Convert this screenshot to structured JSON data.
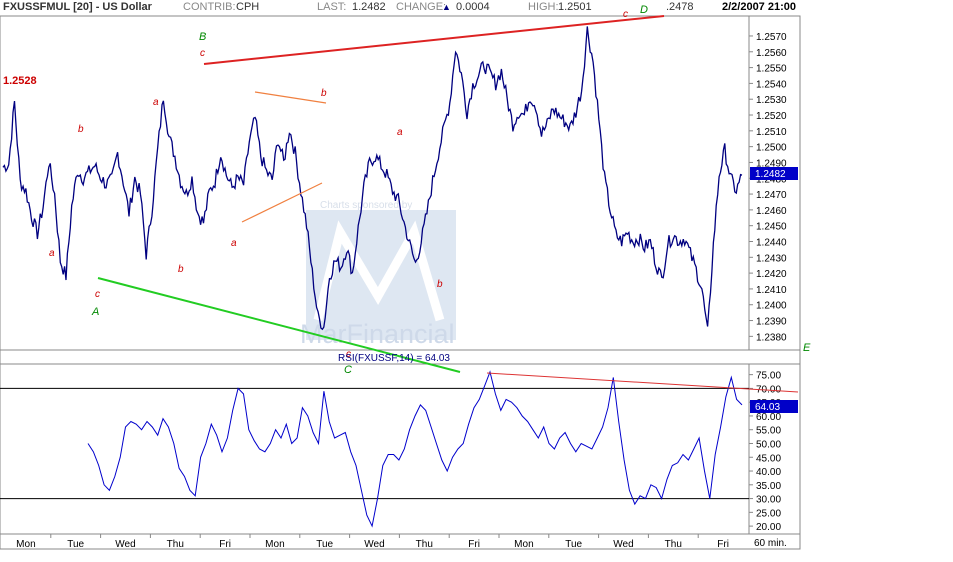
{
  "header": {
    "symbol": "FXUSSFMUL [20] - US Dollar",
    "contrib_label": "CONTRIB:",
    "contrib_value": "CPH",
    "last_label": "LAST:",
    "last_value": "1.2482",
    "change_label": "CHANGE:",
    "change_value": "0.0004",
    "high_label": "HIGH:",
    "high_value": "1.2501",
    "low_value": ".2478",
    "date": "2/2/2007 21:00"
  },
  "colors": {
    "price": "#000080",
    "rsi": "#0000cc",
    "resistance": "#dd2222",
    "support": "#22cc22",
    "triangle": "#f08040",
    "wave_red": "#cc0000",
    "wave_green": "#008800",
    "last_box": "#0000c8"
  },
  "chart_data": [
    {
      "type": "line",
      "title": "FXUSSFMUL [20] - US Dollar",
      "interval": "60 min.",
      "ylim": [
        1.2372,
        1.2582
      ],
      "y_ticks": [
        1.238,
        1.239,
        1.24,
        1.241,
        1.242,
        1.243,
        1.244,
        1.245,
        1.246,
        1.247,
        1.248,
        1.249,
        1.25,
        1.251,
        1.252,
        1.253,
        1.254,
        1.255,
        1.256,
        1.257
      ],
      "last_value": 1.2482,
      "marked_high": "1.2528",
      "watermark": "MarFinancial",
      "watermark_sub": "Charts sponsored by",
      "x_labels": [
        "Mon",
        "Tue",
        "Wed",
        "Thu",
        "Fri",
        "Mon",
        "Tue",
        "Wed",
        "Thu",
        "Fri",
        "Mon",
        "Tue",
        "Wed",
        "Thu",
        "Fri"
      ],
      "series": [
        {
          "values": [
            1.2487,
            1.2489,
            1.2528,
            1.2478,
            1.2472,
            1.2456,
            1.2445,
            1.2462,
            1.249,
            1.247,
            1.2428,
            1.2418,
            1.2462,
            1.2485,
            1.248,
            1.2484,
            1.2488,
            1.2481,
            1.2476,
            1.2479,
            1.2496,
            1.2478,
            1.2458,
            1.248,
            1.247,
            1.2432,
            1.246,
            1.2498,
            1.2532,
            1.2506,
            1.2494,
            1.2478,
            1.247,
            1.248,
            1.2458,
            1.2452,
            1.2471,
            1.2478,
            1.2496,
            1.2482,
            1.2474,
            1.248,
            1.2476,
            1.2503,
            1.2518,
            1.2494,
            1.2484,
            1.2479,
            1.2505,
            1.249,
            1.2511,
            1.2496,
            1.2472,
            1.245,
            1.242,
            1.2392,
            1.2386,
            1.2418,
            1.2428,
            1.2424,
            1.2436,
            1.242,
            1.2448,
            1.2474,
            1.249,
            1.2494,
            1.2488,
            1.2482,
            1.2472,
            1.2466,
            1.2452,
            1.2438,
            1.2426,
            1.244,
            1.2458,
            1.2478,
            1.2496,
            1.2512,
            1.2528,
            1.2562,
            1.2546,
            1.2522,
            1.2539,
            1.2545,
            1.2552,
            1.2546,
            1.254,
            1.2548,
            1.253,
            1.2514,
            1.2522,
            1.252,
            1.2532,
            1.2526,
            1.2508,
            1.2514,
            1.2524,
            1.252,
            1.2516,
            1.2512,
            1.2522,
            1.2536,
            1.2574,
            1.2554,
            1.2518,
            1.248,
            1.246,
            1.2444,
            1.244,
            1.2446,
            1.244,
            1.2442,
            1.2436,
            1.244,
            1.2426,
            1.2416,
            1.2438,
            1.2444,
            1.244,
            1.2442,
            1.2432,
            1.2422,
            1.241,
            1.2382,
            1.2438,
            1.2482,
            1.2498,
            1.248,
            1.2472,
            1.2482
          ]
        }
      ],
      "annotations": [
        {
          "text": "B",
          "color": "green"
        },
        {
          "text": "c",
          "color": "red"
        },
        {
          "text": "D",
          "color": "green"
        },
        {
          "text": "c",
          "color": "red"
        },
        {
          "text": "a",
          "color": "red"
        },
        {
          "text": "b",
          "color": "red"
        },
        {
          "text": "a",
          "color": "red"
        },
        {
          "text": "b",
          "color": "red"
        },
        {
          "text": "a",
          "color": "red"
        },
        {
          "text": "b",
          "color": "red"
        },
        {
          "text": "a",
          "color": "red"
        },
        {
          "text": "b",
          "color": "red"
        },
        {
          "text": "c",
          "color": "red"
        },
        {
          "text": "A",
          "color": "green"
        },
        {
          "text": "c",
          "color": "red"
        },
        {
          "text": "C",
          "color": "green"
        },
        {
          "text": "E",
          "color": "green"
        }
      ]
    },
    {
      "type": "line",
      "title": "RSI(FXUSSF,14) = 64.03",
      "ylim": [
        17.5,
        78.5
      ],
      "y_ticks": [
        20,
        25,
        30,
        35,
        40,
        45,
        50,
        55,
        60,
        65,
        70,
        75
      ],
      "hlines": [
        70,
        30
      ],
      "last_value": "64.03",
      "series": [
        {
          "values": [
            50,
            47,
            42,
            35,
            33,
            38,
            45,
            56,
            58,
            57,
            55,
            58,
            56,
            53,
            59,
            56,
            50,
            41,
            38,
            33,
            31,
            45,
            50,
            57,
            53,
            47,
            52,
            62,
            70,
            68,
            55,
            51,
            48,
            47,
            50,
            55,
            52,
            57,
            50,
            52,
            63,
            60,
            54,
            50,
            69,
            58,
            52,
            53,
            54,
            47,
            42,
            33,
            24,
            20,
            30,
            42,
            46,
            46,
            44,
            48,
            55,
            60,
            64,
            62,
            56,
            50,
            44,
            40,
            45,
            48,
            50,
            57,
            63,
            66,
            71,
            76,
            68,
            62,
            66,
            65,
            63,
            60,
            58,
            55,
            52,
            56,
            50,
            48,
            52,
            54,
            50,
            47,
            50,
            49,
            48,
            52,
            56,
            63,
            74,
            58,
            44,
            33,
            28,
            31,
            30,
            35,
            34,
            30,
            37,
            42,
            43,
            46,
            44,
            48,
            52,
            40,
            30,
            46,
            56,
            67,
            74,
            66,
            64
          ]
        }
      ]
    }
  ]
}
